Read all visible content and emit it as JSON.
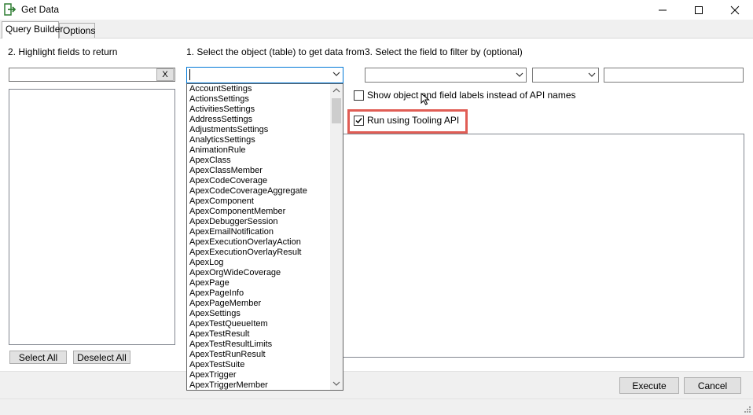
{
  "window": {
    "title": "Get Data",
    "icon": "export-arrow-icon"
  },
  "tabs": [
    {
      "label": "Query Builder",
      "active": true
    },
    {
      "label": "Options",
      "active": false
    }
  ],
  "fields_panel": {
    "label": "2. Highlight fields to return",
    "search_value": "",
    "clear_label": "X",
    "select_all_label": "Select All",
    "deselect_all_label": "Deselect All"
  },
  "object_panel": {
    "label": "1. Select the object (table) to get data from",
    "combo_value": "",
    "list_items": [
      "AccountSettings",
      "ActionsSettings",
      "ActivitiesSettings",
      "AddressSettings",
      "AdjustmentsSettings",
      "AnalyticsSettings",
      "AnimationRule",
      "ApexClass",
      "ApexClassMember",
      "ApexCodeCoverage",
      "ApexCodeCoverageAggregate",
      "ApexComponent",
      "ApexComponentMember",
      "ApexDebuggerSession",
      "ApexEmailNotification",
      "ApexExecutionOverlayAction",
      "ApexExecutionOverlayResult",
      "ApexLog",
      "ApexOrgWideCoverage",
      "ApexPage",
      "ApexPageInfo",
      "ApexPageMember",
      "ApexSettings",
      "ApexTestQueueItem",
      "ApexTestResult",
      "ApexTestResultLimits",
      "ApexTestRunResult",
      "ApexTestSuite",
      "ApexTrigger",
      "ApexTriggerMember"
    ]
  },
  "filter_panel": {
    "label": "3. Select the field to filter by (optional)",
    "field_value": "",
    "operator_value": "",
    "filter_value": "",
    "show_labels_text": "Show object and field labels instead of API names",
    "show_labels_checked": false,
    "tooling_text": "Run using Tooling API",
    "tooling_checked": true
  },
  "footer": {
    "execute_label": "Execute",
    "cancel_label": "Cancel"
  },
  "colors": {
    "highlight": "#e05d55",
    "accent": "#0078d7"
  }
}
